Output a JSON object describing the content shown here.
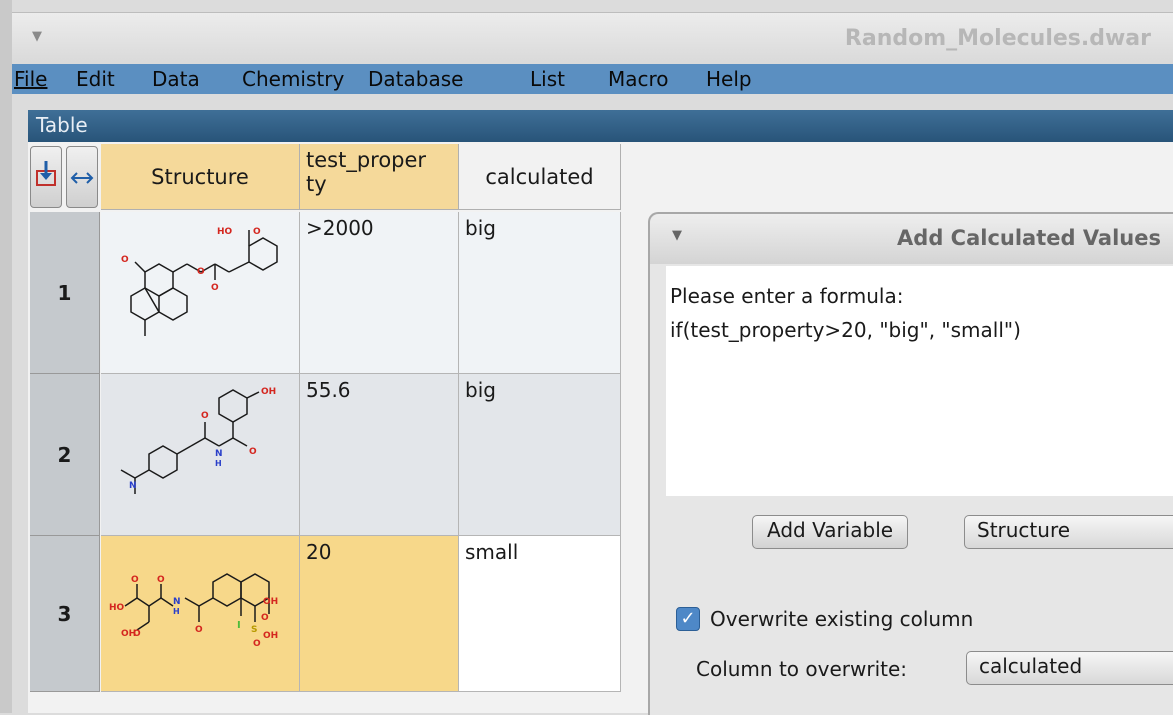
{
  "window": {
    "title": "Random_Molecules.dwar"
  },
  "menu": [
    "File",
    "Edit",
    "Data",
    "Chemistry",
    "Database",
    "List",
    "Macro",
    "Help"
  ],
  "table_panel": {
    "title": "Table"
  },
  "columns": {
    "structure": "Structure",
    "test_property": [
      "test_proper",
      "ty"
    ],
    "calculated": "calculated"
  },
  "rows": [
    {
      "num": "1",
      "test_property": ">2000",
      "calculated": "big",
      "mol_labels": [
        "HO",
        "O"
      ]
    },
    {
      "num": "2",
      "test_property": "55.6",
      "calculated": "big",
      "mol_labels": [
        "OH",
        "O",
        "N",
        "H",
        "O",
        "N"
      ]
    },
    {
      "num": "3",
      "test_property": "20",
      "calculated": "small",
      "mol_labels": [
        "O",
        "O",
        "HO",
        "N",
        "H",
        "O",
        "OH",
        "O",
        "OH",
        "O",
        "S",
        "OH",
        "O"
      ]
    }
  ],
  "dialog": {
    "title": "Add Calculated Values",
    "prompt": "Please enter a formula:",
    "formula": "if(test_property>20, \"big\", \"small\")",
    "add_variable_label": "Add Variable",
    "variable_select": "Structure",
    "overwrite_checked": true,
    "overwrite_label": "Overwrite existing column",
    "column_label": "Column to overwrite:",
    "column_select": "calculated"
  },
  "colors": {
    "menubar": "#5b8fc1",
    "selected_row": "#f7d88a",
    "header_cell": "#f5d99a"
  }
}
